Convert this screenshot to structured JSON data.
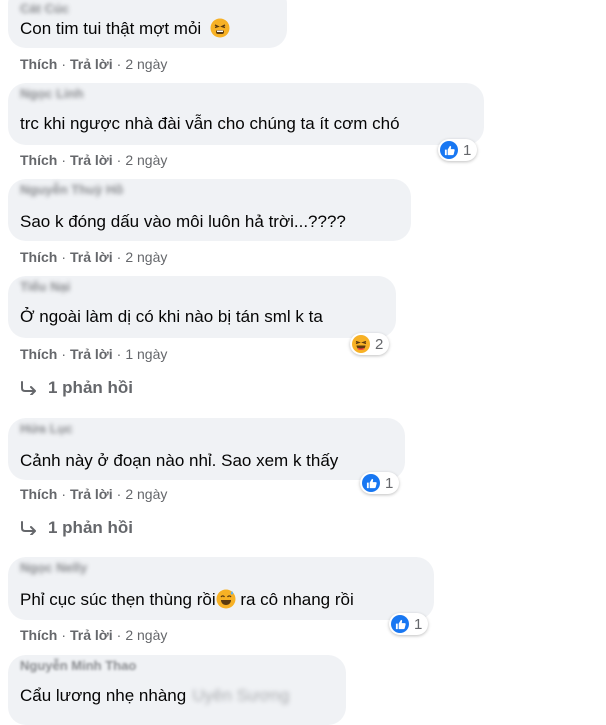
{
  "comments": [
    {
      "author": "Cát Cúc",
      "text": "Con tim tui thật mợt mỏi",
      "like": "Thích",
      "reply": "Trả lời",
      "time": "2 ngày"
    },
    {
      "author": "Ngọc Linh",
      "text": "trc khi ngược nhà đài vẫn cho chúng ta ít cơm chó",
      "like": "Thích",
      "reply": "Trả lời",
      "time": "2 ngày",
      "reaction_count": "1"
    },
    {
      "author": "Nguyễn Thuỳ Hồ",
      "text": "Sao k đóng dấu vào môi luôn hả trời...????",
      "like": "Thích",
      "reply": "Trả lời",
      "time": "2 ngày"
    },
    {
      "author": "Tiểu Nại",
      "text": "Ở ngoài làm dị có khi nào bị tán sml k ta",
      "like": "Thích",
      "reply": "Trả lời",
      "time": "1 ngày",
      "reaction_count": "2",
      "replies": "1 phản hồi"
    },
    {
      "author": "Hứa Lục",
      "text": "Cảnh này ở đoạn nào nhỉ. Sao xem k thấy",
      "like": "Thích",
      "reply": "Trả lời",
      "time": "2 ngày",
      "reaction_count": "1",
      "replies": "1 phản hồi"
    },
    {
      "author": "Ngọc Nelly",
      "text_before": "Phỉ cục súc thẹn thùng rồi",
      "text_after": " ra cô nhang rồi",
      "like": "Thích",
      "reply": "Trả lời",
      "time": "2 ngày",
      "reaction_count": "1"
    },
    {
      "author": "Nguyễn Minh Thao",
      "text": "Cẩu lương nhẹ nhàng",
      "mention": "Uyên Sương"
    }
  ],
  "icons": {
    "like": "thumbs-up-icon",
    "haha": "haha-emoji-icon",
    "reply": "reply-arrow-icon",
    "tired": "tired-face-emoji-icon",
    "sweat": "sweat-smile-emoji-icon"
  }
}
